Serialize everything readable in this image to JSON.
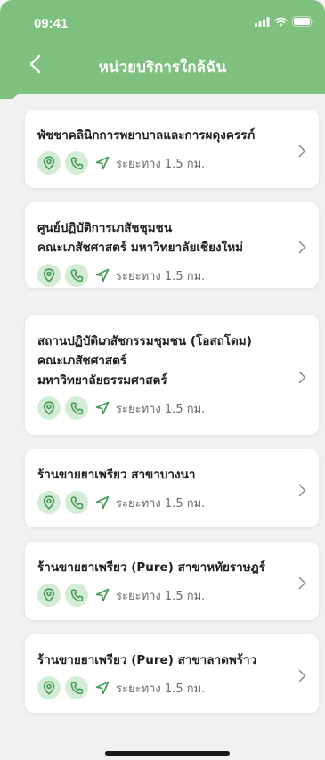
{
  "status_bar": {
    "time": "09:41"
  },
  "header": {
    "title": "หน่วยบริการใกล้ฉัน"
  },
  "colors": {
    "header_bg": "#7ec07e",
    "icon_circle_bg": "#d4ecd5",
    "icon_green": "#3f9b57"
  },
  "icons": {
    "back": "chevron-left-icon",
    "location": "location-pin-icon",
    "phone": "phone-icon",
    "navigate": "navigation-arrow-icon",
    "open": "chevron-right-icon"
  },
  "services": [
    {
      "name_line1": "พัชชาคลินิกการพยาบาลและการผดุงครรภ์",
      "name_line2": "",
      "name_line3": "",
      "distance": "ระยะทาง 1.5 กม."
    },
    {
      "name_line1": "ศูนย์ปฏิบัติการเภสัชชุมชน",
      "name_line2": "คณะเภสัชศาสตร์ มหาวิทยาลัยเชียงใหม่",
      "name_line3": "",
      "distance": "ระยะทาง 1.5 กม."
    },
    {
      "name_line1": "สถานปฏิบัติเภสัชกรรมชุมชน (โอสถโดม)",
      "name_line2": "คณะเภสัชศาสตร์",
      "name_line3": "มหาวิทยาลัยธรรมศาสตร์",
      "distance": "ระยะทาง 1.5 กม."
    },
    {
      "name_line1": "ร้านขายยาเพรียว สาขาบางนา",
      "name_line2": "",
      "name_line3": "",
      "distance": "ระยะทาง 1.5 กม."
    },
    {
      "name_line1": "ร้านขายยาเพรียว (Pure) สาขาหทัยราษฎร์",
      "name_line2": "",
      "name_line3": "",
      "distance": "ระยะทาง 1.5 กม."
    },
    {
      "name_line1": "ร้านขายยาเพรียว (Pure) สาขาลาดพร้าว",
      "name_line2": "",
      "name_line3": "",
      "distance": "ระยะทาง 1.5 กม."
    }
  ]
}
